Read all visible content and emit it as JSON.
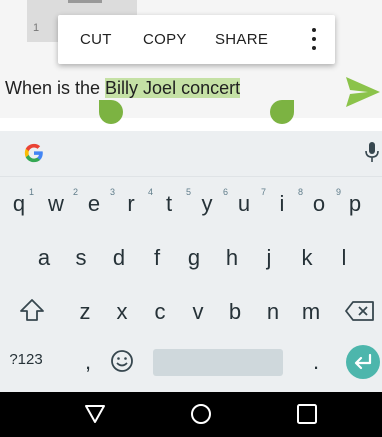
{
  "background": {
    "thumb_text": "1"
  },
  "context_menu": {
    "cut": "CUT",
    "copy": "COPY",
    "share": "SHARE",
    "more_icon": "more-vertical-icon"
  },
  "compose": {
    "text_before": "When is the ",
    "text_selected": "Billy Joel concert",
    "send_icon": "send-icon",
    "send_color": "#8bc34a",
    "selection_color": "#c5e1a5",
    "handle_color": "#7cb342"
  },
  "keyboard": {
    "google_icon": "google-g-icon",
    "mic_icon": "mic-icon",
    "row1": [
      "q",
      "w",
      "e",
      "r",
      "t",
      "y",
      "u",
      "i",
      "o",
      "p"
    ],
    "row1_nums": [
      "1",
      "2",
      "3",
      "4",
      "5",
      "6",
      "7",
      "8",
      "9"
    ],
    "row2": [
      "a",
      "s",
      "d",
      "f",
      "g",
      "h",
      "j",
      "k",
      "l"
    ],
    "row3": [
      "z",
      "x",
      "c",
      "v",
      "b",
      "n",
      "m"
    ],
    "shift_icon": "shift-icon",
    "backspace_icon": "backspace-icon",
    "symbols_key": "?123",
    "comma_key": ",",
    "emoji_icon": "emoji-icon",
    "period_key": ".",
    "enter_icon": "enter-icon",
    "accent_color": "#4db6ac"
  },
  "navbar": {
    "back_icon": "back-triangle-icon",
    "home_icon": "home-circle-icon",
    "recents_icon": "recents-square-icon"
  }
}
